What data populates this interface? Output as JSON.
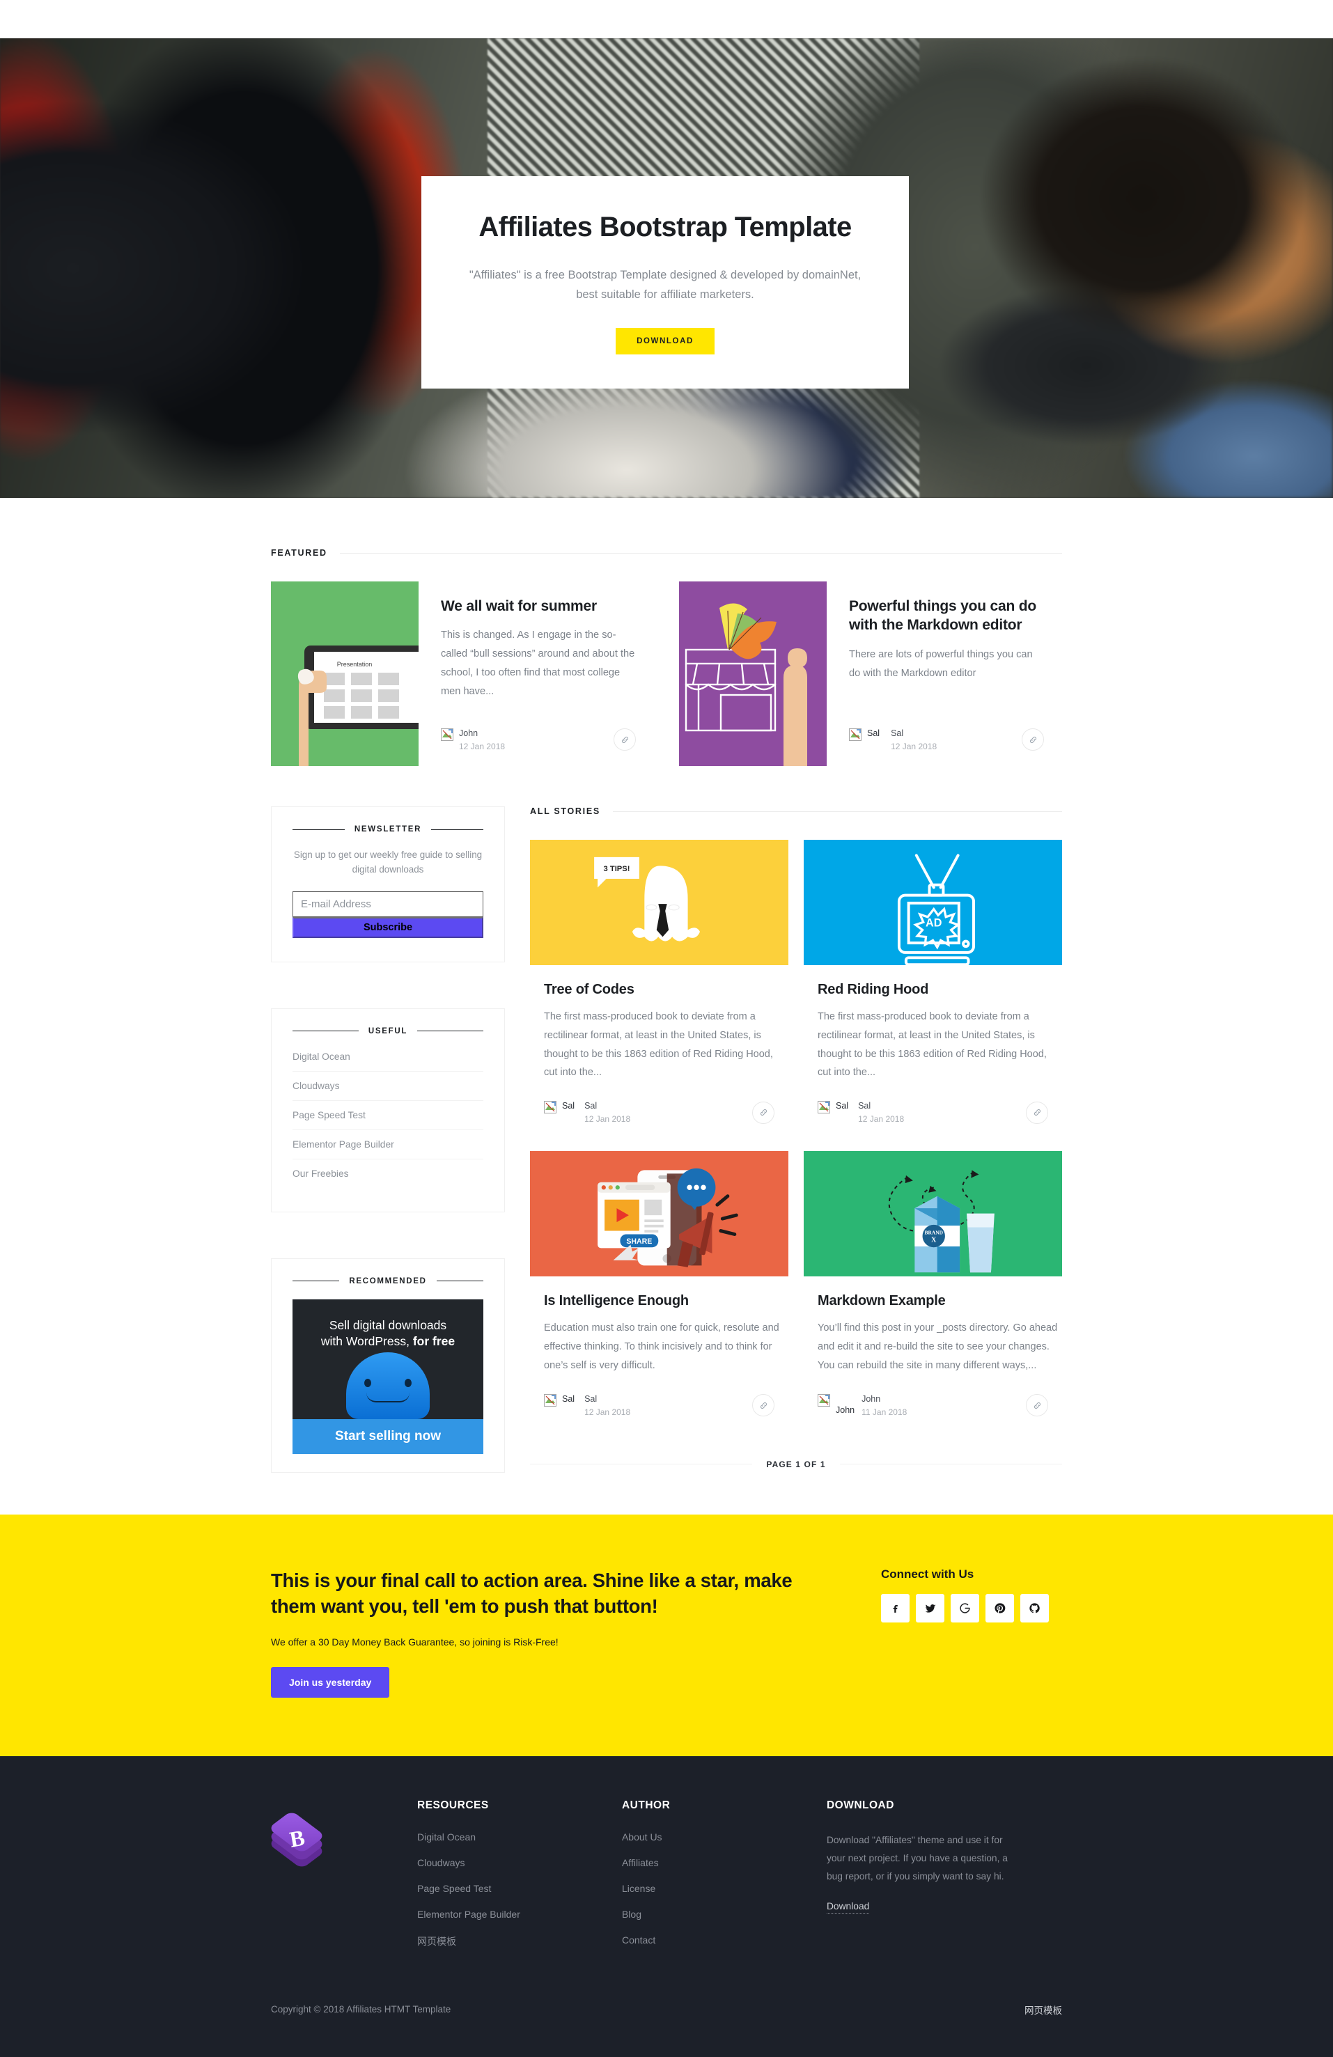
{
  "hero": {
    "title": "Affiliates Bootstrap Template",
    "subtitle": "\"Affiliates\" is a free Bootstrap Template designed & developed by domainNet, best suitable for affiliate marketers.",
    "button": "DOWNLOAD",
    "accent_color": "#ffe600"
  },
  "featured": {
    "heading": "FEATURED",
    "cards": [
      {
        "title": "We all wait for summer",
        "excerpt": "This is changed. As I engage in the so-called “bull sessions” around and about the school, I too often find that most college men have...",
        "author": "John",
        "author_alt": "John",
        "date": "12 Jan 2018",
        "thumb_color": "#67bb6a",
        "thumb_kind": "tablet-presentation"
      },
      {
        "title": "Powerful things you can do with the Markdown editor",
        "excerpt": "There are lots of powerful things you can do with the Markdown editor",
        "author": "Sal",
        "author_alt": "Sal",
        "date": "12 Jan 2018",
        "thumb_color": "#8e4ca0",
        "thumb_kind": "shop-front"
      }
    ]
  },
  "sidebar": {
    "newsletter": {
      "heading": "NEWSLETTER",
      "text": "Sign up to get our weekly free guide to selling digital downloads",
      "placeholder": "E-mail Address",
      "value": "",
      "button": "Subscribe",
      "button_color": "#5c4af2"
    },
    "useful": {
      "heading": "USEFUL",
      "items": [
        "Digital Ocean",
        "Cloudways",
        "Page Speed Test",
        "Elementor Page Builder",
        "Our Freebies"
      ]
    },
    "recommended": {
      "heading": "RECOMMENDED",
      "promo_line1": "Sell digital downloads",
      "promo_line2_plain": "with WordPress, ",
      "promo_line2_bold": "for free",
      "promo_cta": "Start selling now",
      "promo_bg": "#22262b",
      "promo_cta_bg": "#3296e4"
    }
  },
  "stories": {
    "heading": "ALL STORIES",
    "cards": [
      {
        "title": "Tree of Codes",
        "excerpt": "The first mass-produced book to deviate from a rectilinear format, at least in the United States, is thought to be this 1863 edition of Red Riding Hood, cut into the...",
        "author": "Sal",
        "author_alt": "Sal",
        "date": "12 Jan 2018",
        "thumb_color": "#fcd03b",
        "thumb_kind": "ghost-3tips",
        "thumb_label": "3 TIPS!"
      },
      {
        "title": "Red Riding Hood",
        "excerpt": "The first mass-produced book to deviate from a rectilinear format, at least in the United States, is thought to be this 1863 edition of Red Riding Hood, cut into the...",
        "author": "Sal",
        "author_alt": "Sal",
        "date": "12 Jan 2018",
        "thumb_color": "#00a7e7",
        "thumb_kind": "tv-ad",
        "thumb_label": "AD"
      },
      {
        "title": "Is Intelligence Enough",
        "excerpt": "Education must also train one for quick, resolute and effective thinking. To think incisively and to think for one’s self is very difficult.",
        "author": "Sal",
        "author_alt": "Sal",
        "date": "12 Jan 2018",
        "thumb_color": "#ea6645",
        "thumb_kind": "share-megaphone",
        "thumb_label": "SHARE"
      },
      {
        "title": "Markdown Example",
        "excerpt": "You’ll find this post in your _posts directory. Go ahead and edit it and re-build the site to see your changes. You can rebuild the site in many different ways,...",
        "author": "John",
        "author_alt": "John",
        "date": "11 Jan 2018",
        "thumb_color": "#2bb673",
        "thumb_kind": "milk-carton",
        "thumb_label": "BRAND X"
      }
    ],
    "pagination": "PAGE 1 OF 1"
  },
  "cta": {
    "heading": "This is your final call to action area. Shine like a star, make them want you, tell 'em to push that button!",
    "subtext": "We offer a 30 Day Money Back Guarantee, so joining is Risk-Free!",
    "button": "Join us yesterday",
    "connect_heading": "Connect with Us",
    "bg_color": "#ffe600",
    "socials": [
      "facebook",
      "twitter",
      "google",
      "pinterest",
      "github"
    ]
  },
  "footer": {
    "bg_color": "#1c2029",
    "resources": {
      "heading": "RESOURCES",
      "items": [
        "Digital Ocean",
        "Cloudways",
        "Page Speed Test",
        "Elementor Page Builder",
        "网页模板"
      ]
    },
    "author": {
      "heading": "AUTHOR",
      "items": [
        "About Us",
        "Affiliates",
        "License",
        "Blog",
        "Contact"
      ]
    },
    "download": {
      "heading": "DOWNLOAD",
      "text": "Download \"Affiliates\" theme and use it for your next project. If you have a question, a bug report, or if you simply want to say hi.",
      "link": "Download"
    },
    "copyright": "Copyright © 2018 Affiliates HTMT Template",
    "right_label": "网页模板"
  }
}
